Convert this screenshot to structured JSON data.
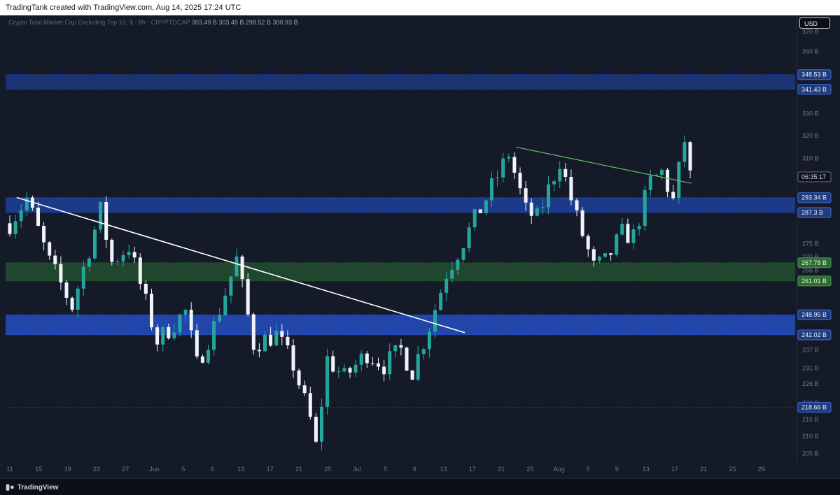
{
  "header": {
    "text": "TradingTank created with TradingView.com, Aug 14, 2025 17:24 UTC"
  },
  "symbol": {
    "name": "Crypto Total Market Cap Excluding Top 10, $ · 8h · CRYPTOCAP",
    "open": "303.49 B",
    "high": "303.49 B",
    "low": "298.52 B",
    "close": "300.93 B"
  },
  "currency_button": "USD",
  "footer": {
    "brand": "TradingView"
  },
  "colors": {
    "background": "#141a28",
    "up_candle": "#26a69a",
    "down_candle": "#f0f3fa",
    "zone_blue": "#2962ff",
    "zone_green": "#2e7d32",
    "trendline_white": "#ffffff",
    "trendline_green": "#66bb6a"
  },
  "chart_data": {
    "type": "candlestick",
    "y_axis": {
      "scale": "log",
      "ylim": [
        202.3,
        378.7
      ],
      "ticks": [
        "370 B",
        "360 B",
        "330 B",
        "320 B",
        "310 B",
        "275 B",
        "270 B",
        "265 B",
        "237 B",
        "231 B",
        "226 B",
        "220 B",
        "215 B",
        "210 B",
        "205 B"
      ]
    },
    "x_axis": {
      "ticks": [
        "11",
        "15",
        "19",
        "23",
        "27",
        "Jun",
        "5",
        "9",
        "13",
        "17",
        "21",
        "25",
        "Jul",
        "5",
        "9",
        "13",
        "17",
        "21",
        "25",
        "Aug",
        "5",
        "9",
        "13",
        "17",
        "21",
        "25",
        "29"
      ]
    },
    "price_labels": [
      {
        "text": "348.53 B",
        "value": 348.53,
        "style": "blue"
      },
      {
        "text": "341.43 B",
        "value": 341.43,
        "style": "blue"
      },
      {
        "text": "06:35:17",
        "value": 302.0,
        "style": "countdown"
      },
      {
        "text": "293.34 B",
        "value": 293.34,
        "style": "blue"
      },
      {
        "text": "287.3 B",
        "value": 287.3,
        "style": "blue"
      },
      {
        "text": "267.78 B",
        "value": 267.78,
        "style": "green"
      },
      {
        "text": "261.01 B",
        "value": 261.01,
        "style": "green"
      },
      {
        "text": "248.95 B",
        "value": 248.95,
        "style": "blue"
      },
      {
        "text": "242.02 B",
        "value": 242.02,
        "style": "blue"
      },
      {
        "text": "218.66 B",
        "value": 218.66,
        "style": "blue"
      }
    ],
    "zones": [
      {
        "from": 341.43,
        "to": 348.53,
        "color": "blue",
        "opacity": 0.35
      },
      {
        "from": 287.3,
        "to": 293.34,
        "color": "blue",
        "opacity": 0.45
      },
      {
        "from": 261.01,
        "to": 267.78,
        "color": "green",
        "opacity": 0.45
      },
      {
        "from": 242.02,
        "to": 248.95,
        "color": "blue",
        "opacity": 0.6
      }
    ],
    "hlines": [
      {
        "value": 218.66,
        "style": "dotted"
      }
    ],
    "trendlines": [
      {
        "color": "white",
        "points": [
          [
            0,
            293.4
          ],
          [
            79,
            242.8
          ]
        ]
      },
      {
        "color": "green",
        "points": [
          [
            88,
            314.9
          ],
          [
            119,
            299.3
          ]
        ]
      }
    ],
    "anchors": [
      {
        "i": 0,
        "value": 283.0
      },
      {
        "i": 3,
        "value": 293.0
      },
      {
        "i": 7,
        "value": 268.0
      },
      {
        "i": 11,
        "value": 252.0
      },
      {
        "i": 16,
        "value": 288.0
      },
      {
        "i": 18,
        "value": 268.0
      },
      {
        "i": 21,
        "value": 274.0
      },
      {
        "i": 26,
        "value": 240.0
      },
      {
        "i": 31,
        "value": 250.0
      },
      {
        "i": 33,
        "value": 232.0
      },
      {
        "i": 36,
        "value": 245.0
      },
      {
        "i": 40,
        "value": 269.0
      },
      {
        "i": 43,
        "value": 239.0
      },
      {
        "i": 47,
        "value": 242.0
      },
      {
        "i": 50,
        "value": 232.0
      },
      {
        "i": 53,
        "value": 215.0
      },
      {
        "i": 54,
        "value": 207.0
      },
      {
        "i": 56,
        "value": 234.0
      },
      {
        "i": 59,
        "value": 228.0
      },
      {
        "i": 63,
        "value": 236.0
      },
      {
        "i": 66,
        "value": 232.0
      },
      {
        "i": 69,
        "value": 237.0
      },
      {
        "i": 71,
        "value": 230.0
      },
      {
        "i": 74,
        "value": 245.0
      },
      {
        "i": 77,
        "value": 264.0
      },
      {
        "i": 80,
        "value": 276.0
      },
      {
        "i": 84,
        "value": 293.0
      },
      {
        "i": 88,
        "value": 312.0
      },
      {
        "i": 91,
        "value": 288.0
      },
      {
        "i": 93,
        "value": 285.0
      },
      {
        "i": 97,
        "value": 309.0
      },
      {
        "i": 100,
        "value": 285.0
      },
      {
        "i": 103,
        "value": 266.0
      },
      {
        "i": 105,
        "value": 268.0
      },
      {
        "i": 108,
        "value": 279.0
      },
      {
        "i": 110,
        "value": 278.0
      },
      {
        "i": 113,
        "value": 300.0
      },
      {
        "i": 115,
        "value": 304.0
      },
      {
        "i": 117,
        "value": 292.0
      },
      {
        "i": 119,
        "value": 318.0
      },
      {
        "i": 120,
        "value": 302.0
      }
    ]
  }
}
